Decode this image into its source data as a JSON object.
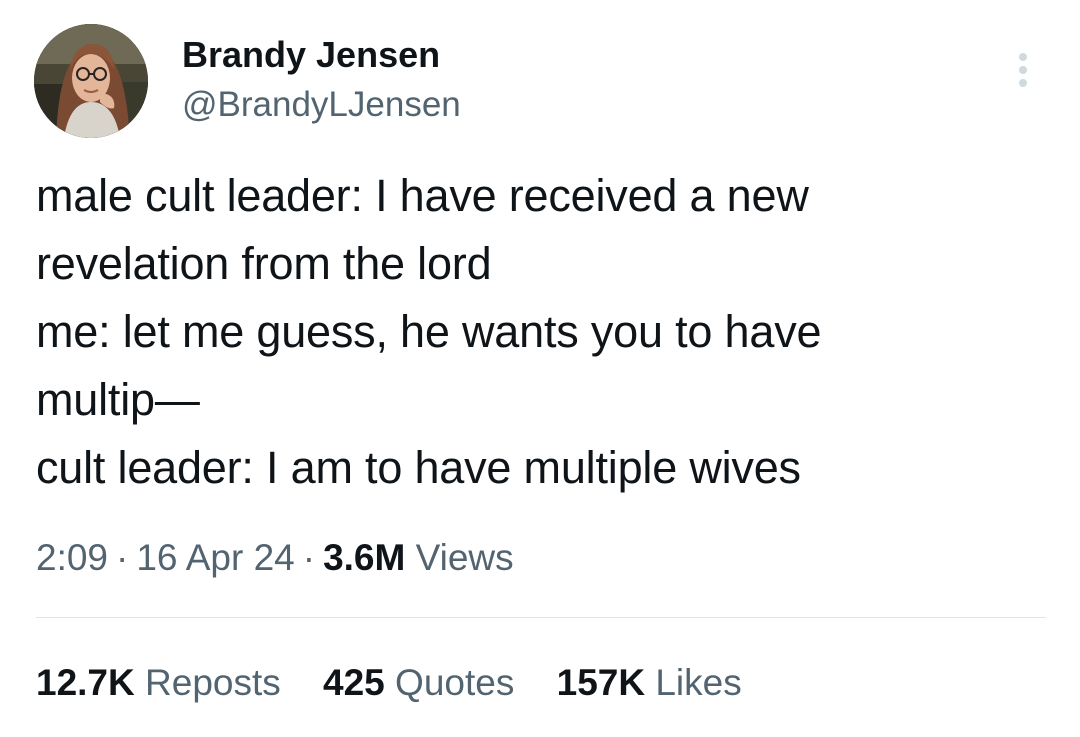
{
  "author": {
    "display_name": "Brandy Jensen",
    "handle": "@BrandyLJensen"
  },
  "tweet": {
    "lines": [
      "male cult leader: I have received a new",
      "revelation from the lord",
      "me: let me guess, he wants you to have",
      "multip—",
      "cult leader: I am to have multiple wives"
    ]
  },
  "meta": {
    "time": "2:09",
    "separator": "·",
    "date": "16 Apr 24",
    "views_count": "3.6M",
    "views_label": "Views"
  },
  "stats": {
    "reposts": {
      "count": "12.7K",
      "label": "Reposts"
    },
    "quotes": {
      "count": "425",
      "label": "Quotes"
    },
    "likes": {
      "count": "157K",
      "label": "Likes"
    }
  },
  "icons": {
    "more": "more-vertical-icon"
  },
  "colors": {
    "text_primary": "#0f1419",
    "text_secondary": "#536471",
    "divider": "#e1e6ea",
    "more_icon": "#cfd9de"
  }
}
